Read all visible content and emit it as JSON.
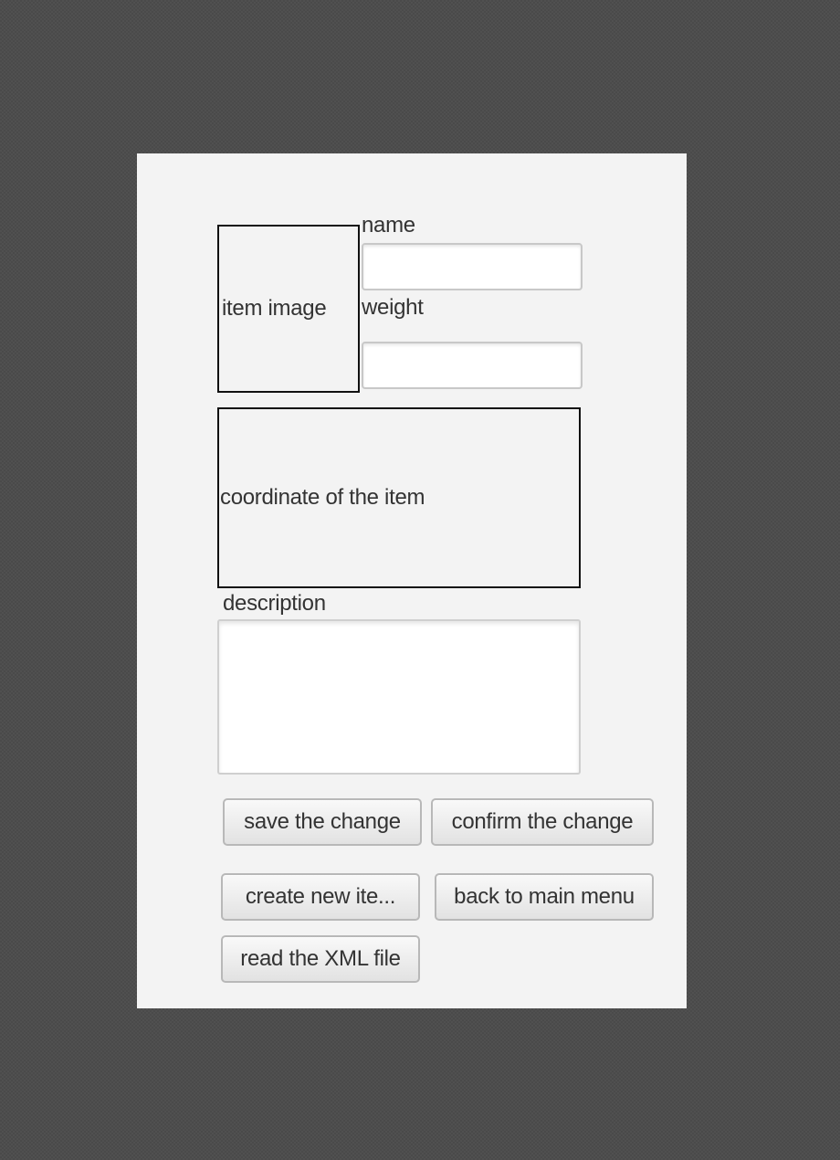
{
  "form": {
    "item_image_label": "item image",
    "name_label": "name",
    "name_value": "",
    "weight_label": "weight",
    "weight_value": "",
    "coordinate_label": "coordinate of the item",
    "description_label": "description",
    "description_value": ""
  },
  "buttons": {
    "save": "save the change",
    "confirm": "confirm the change",
    "create": "create new ite...",
    "back": "back to main menu",
    "read_xml": "read the XML file"
  },
  "colors": {
    "background": "#505050",
    "panel": "#f3f3f3",
    "text": "#333333"
  }
}
